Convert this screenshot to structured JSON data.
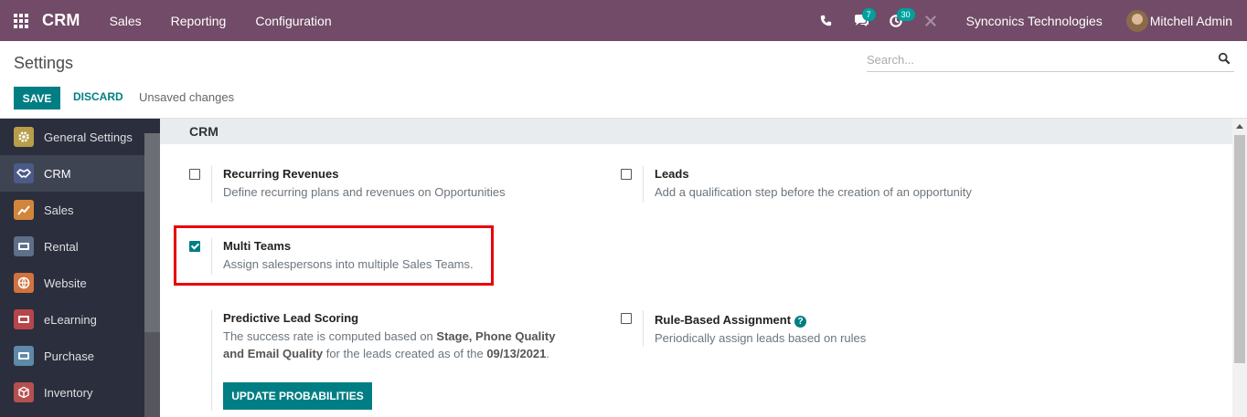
{
  "navbar": {
    "app_name": "CRM",
    "menu": [
      "Sales",
      "Reporting",
      "Configuration"
    ],
    "messages_count": "7",
    "activities_count": "30",
    "company": "Synconics Technologies",
    "user": "Mitchell Admin",
    "bg_color": "#714b67"
  },
  "control_panel": {
    "title": "Settings",
    "search_placeholder": "Search...",
    "save_label": "SAVE",
    "discard_label": "DISCARD",
    "status": "Unsaved changes"
  },
  "sidebar": {
    "items": [
      {
        "label": "General Settings",
        "icon": "gear-icon",
        "color": "#b69e4a"
      },
      {
        "label": "CRM",
        "icon": "handshake-icon",
        "color": "#4c5a8a",
        "active": true
      },
      {
        "label": "Sales",
        "icon": "chart-icon",
        "color": "#d2863b"
      },
      {
        "label": "Rental",
        "icon": "rental-icon",
        "color": "#5d6f89"
      },
      {
        "label": "Website",
        "icon": "globe-icon",
        "color": "#d1733e"
      },
      {
        "label": "eLearning",
        "icon": "elearning-icon",
        "color": "#b7464c"
      },
      {
        "label": "Purchase",
        "icon": "purchase-icon",
        "color": "#5e89a8"
      },
      {
        "label": "Inventory",
        "icon": "box-icon",
        "color": "#b5504f"
      }
    ]
  },
  "section": {
    "title": "CRM",
    "settings": {
      "recurring": {
        "title": "Recurring Revenues",
        "desc": "Define recurring plans and revenues on Opportunities",
        "checked": false
      },
      "leads": {
        "title": "Leads",
        "desc": "Add a qualification step before the creation of an opportunity",
        "checked": false
      },
      "multi_teams": {
        "title": "Multi Teams",
        "desc": "Assign salespersons into multiple Sales Teams.",
        "checked": true
      },
      "predictive": {
        "title": "Predictive Lead Scoring",
        "desc_1": "The success rate is computed based on ",
        "desc_bold_1": "Stage, Phone Quality and Email Quality",
        "desc_2": " for the leads created as of the ",
        "desc_bold_2": "09/13/2021",
        "desc_3": ".",
        "button": "UPDATE PROBABILITIES"
      },
      "rule_based": {
        "title": "Rule-Based Assignment",
        "desc": "Periodically assign leads based on rules",
        "checked": false
      }
    }
  },
  "colors": {
    "accent": "#017e84",
    "highlight": "#e8000c"
  }
}
